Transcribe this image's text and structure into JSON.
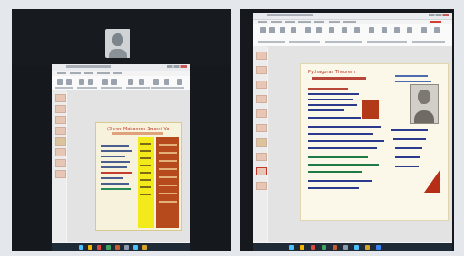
{
  "meeting": {
    "left_tile": {
      "label": "participant-tile-left"
    },
    "right_tile": {
      "label": "participant-tile-right"
    }
  },
  "left_presentation": {
    "slide_title": "(Shree Mahaveer Swami Vani Lekhan)"
  },
  "right_presentation": {
    "slide_heading": "Pythagoras Theorem"
  },
  "colors": {
    "background": "#e4e8ec",
    "panel": "#15181d",
    "yellow_column": "#f3ea1b",
    "red_column": "#b64a1c",
    "slide_red": "#c2311f"
  }
}
